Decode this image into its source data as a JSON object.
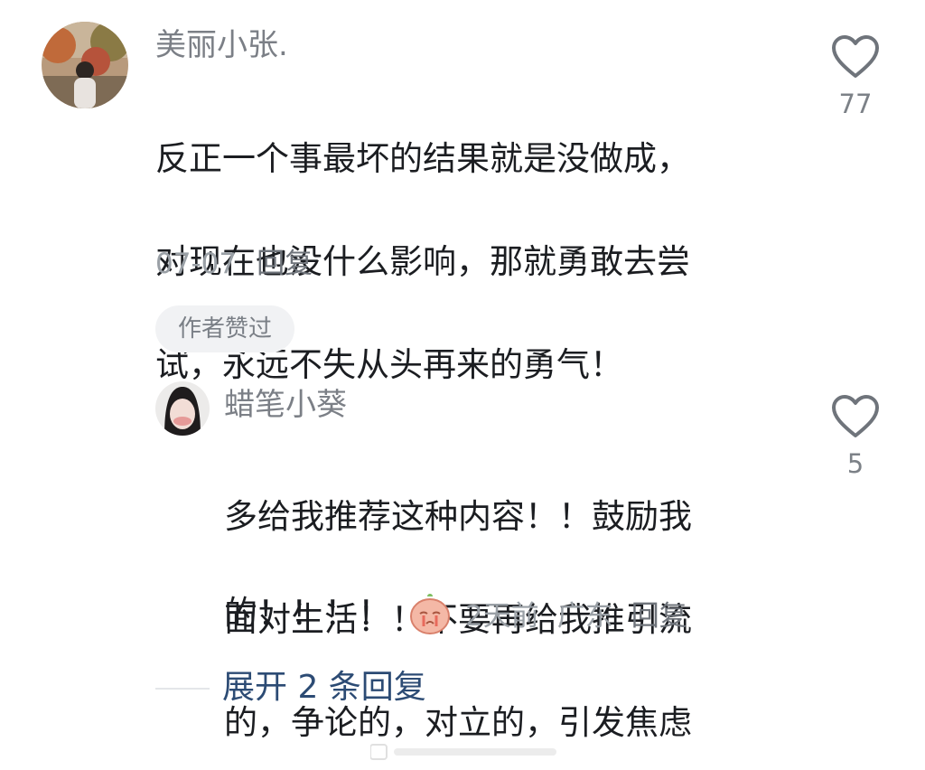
{
  "comment": {
    "username": "美丽小张.",
    "text_lines": [
      "反正一个事最坏的结果就是没做成，",
      "对现在也没什么影响，那就勇敢去尝",
      "试，永远不失从头再来的勇气！"
    ],
    "date": "07-07",
    "reply_label": "回复",
    "author_liked_label": "作者赞过",
    "like_count": "77"
  },
  "reply": {
    "username": "蜡笔小葵",
    "text_lines": [
      "多给我推荐这种内容！！鼓励我",
      "面对生活！！不要再给我推引流",
      "的，争论的，对立的，引发焦虑"
    ],
    "last_line": "的！！！！",
    "emoji_name": "crying-face-emoji",
    "time": "2天前",
    "location": "广东",
    "reply_label": "回复",
    "like_count": "5"
  },
  "expand_replies_label": "展开 2 条回复",
  "colors": {
    "text": "#1b1d21",
    "secondary": "#9aa0a6",
    "link": "#2c4b74",
    "chip_bg": "#f1f2f4"
  }
}
